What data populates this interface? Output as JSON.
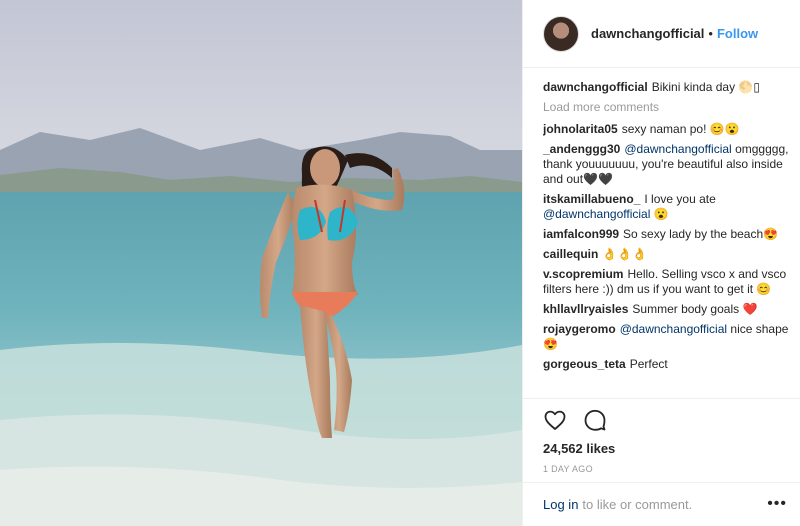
{
  "post": {
    "username": "dawnchangofficial",
    "follow_label": "Follow",
    "separator": "•"
  },
  "caption": {
    "user": "dawnchangofficial",
    "text": "Bikini kinda day 🌕▯"
  },
  "load_more_label": "Load more comments",
  "comments": [
    {
      "user": "johnolarita05",
      "text": "sexy naman po! 😊😮"
    },
    {
      "user": "_andenggg30",
      "mention": "@dawnchangofficial",
      "text": "omggggg, thank youuuuuuu, you're beautiful also inside and out🖤🖤"
    },
    {
      "user": "itskamillabueno_",
      "text": "I love you ate",
      "mention_after": "@dawnchangofficial",
      "after": " 😮"
    },
    {
      "user": "iamfalcon999",
      "text": "So sexy lady by the beach😍"
    },
    {
      "user": "caillequin",
      "text": "👌👌👌"
    },
    {
      "user": "v.scopremium",
      "text": "Hello. Selling vsco x and vsco filters here :)) dm us if you want to get it 😊"
    },
    {
      "user": "khllavllryaisles",
      "text": "Summer body goals ❤️"
    },
    {
      "user": "rojaygeromo",
      "mention": "@dawnchangofficial",
      "text": "nice shape 😍"
    },
    {
      "user": "gorgeous_teta",
      "text": "Perfect"
    }
  ],
  "likes": "24,562 likes",
  "time": "1 DAY AGO",
  "footer": {
    "login_label": "Log in",
    "rest": "to like or comment.",
    "more_label": "•••"
  },
  "icons": {
    "like": "heart-icon",
    "comment": "speech-bubble-icon",
    "more": "more-options-icon"
  },
  "colors": {
    "link": "#3897f0",
    "mention": "#003569",
    "muted": "#999999",
    "text": "#262626"
  }
}
